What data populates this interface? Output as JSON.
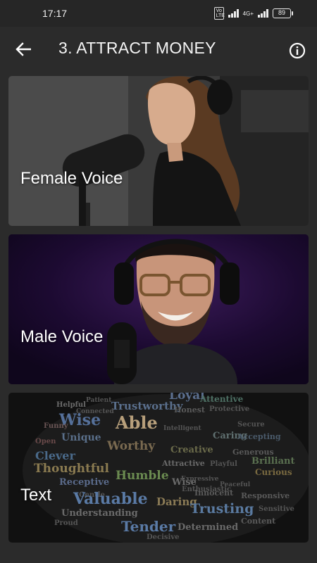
{
  "status_bar": {
    "time": "17:17",
    "volte": "Vo LTE",
    "network": "4G+",
    "battery": "89"
  },
  "toolbar": {
    "title": "3. ATTRACT MONEY",
    "back_icon": "arrow-left-icon",
    "info_icon": "info-circle-icon"
  },
  "cards": [
    {
      "label": "Female Voice",
      "image": "woman-with-microphone-and-headphones"
    },
    {
      "label": "Male Voice",
      "image": "man-with-glasses-headphones-and-microphone"
    },
    {
      "label": "Text",
      "image": "positive-words-cloud"
    }
  ],
  "word_cloud": {
    "words": [
      "Loyal",
      "Attentive",
      "Helpful",
      "Patient",
      "Trustworthy",
      "Honest",
      "Protective",
      "Connected",
      "Wise",
      "Able",
      "Funny",
      "Secure",
      "Caring",
      "Unique",
      "Worthy",
      "Intelligent",
      "Open",
      "Accepting",
      "Clever",
      "Creative",
      "Generous",
      "Brilliant",
      "Thoughtful",
      "Humble",
      "Curious",
      "Receptive",
      "Attractive",
      "Playful",
      "Gentle",
      "Valuable",
      "Daring",
      "Wise",
      "Trusting",
      "Enthusiastic",
      "Understanding",
      "Tender",
      "Determined",
      "Proud",
      "Decisive",
      "Innocent",
      "Expressive",
      "Responsive",
      "Content",
      "Peaceful",
      "Sensitive"
    ]
  }
}
